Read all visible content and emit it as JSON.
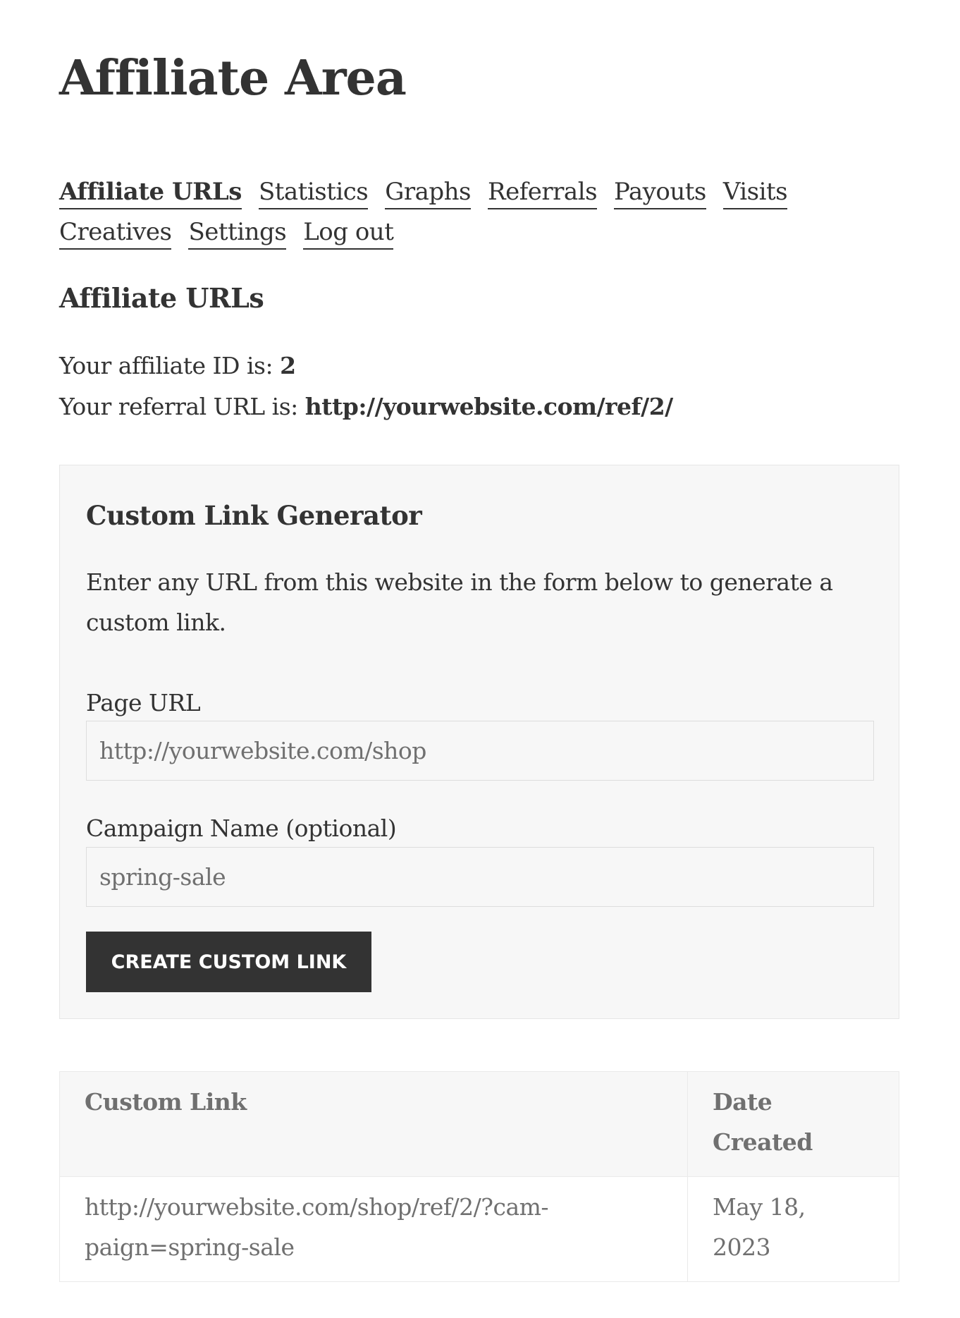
{
  "page": {
    "title": "Affiliate Area"
  },
  "nav": {
    "items": [
      {
        "label": "Affiliate URLs",
        "active": true
      },
      {
        "label": "Statistics",
        "active": false
      },
      {
        "label": "Graphs",
        "active": false
      },
      {
        "label": "Referrals",
        "active": false
      },
      {
        "label": "Payouts",
        "active": false
      },
      {
        "label": "Visits",
        "active": false
      },
      {
        "label": "Creatives",
        "active": false
      },
      {
        "label": "Settings",
        "active": false
      },
      {
        "label": "Log out",
        "active": false
      }
    ]
  },
  "affiliate_urls": {
    "heading": "Affiliate URLs",
    "id_label": "Your affiliate ID is: ",
    "id_value": "2",
    "referral_label": "Your referral URL is: ",
    "referral_value": "http://yourwebsite.com/ref/2/"
  },
  "generator": {
    "title": "Custom Link Generator",
    "description": "Enter any URL from this website in the form below to generate a custom link.",
    "page_url_label": "Page URL",
    "page_url_placeholder": "http://yourwebsite.com/shop",
    "page_url_value": "",
    "campaign_label": "Campaign Name (optional)",
    "campaign_placeholder": "spring-sale",
    "campaign_value": "",
    "submit_label": "Create Custom Link"
  },
  "links_table": {
    "columns": [
      "Custom Link",
      "Date Created"
    ],
    "rows": [
      {
        "link": "http://yourwebsite.com/shop/ref/2/?cam­paign=spring-sale",
        "date": "May 18, 2023"
      }
    ]
  },
  "colors": {
    "text": "#333333",
    "muted_text": "#707070",
    "panel_bg": "#f7f7f7",
    "button_bg": "#333333",
    "button_text": "#ffffff"
  }
}
